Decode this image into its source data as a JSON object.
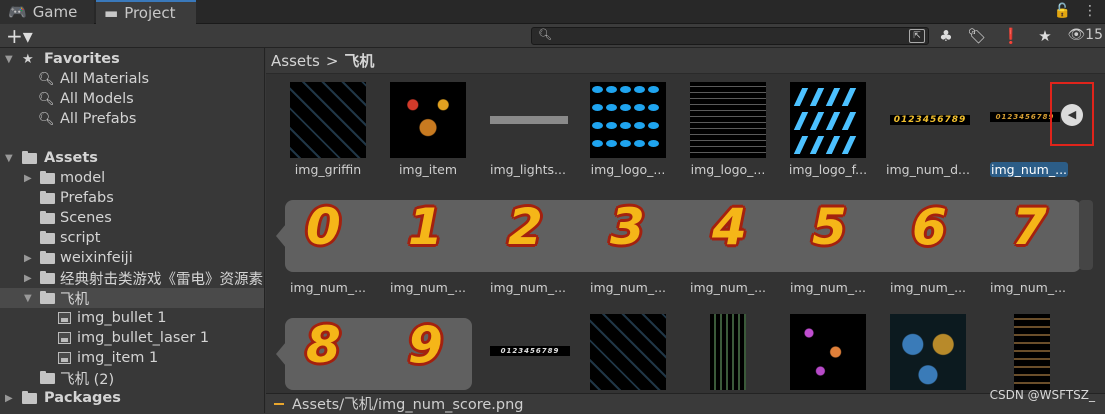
{
  "tabs": [
    {
      "label": "Game"
    },
    {
      "label": "Project"
    }
  ],
  "toolbar": {
    "add_label": "+▾",
    "hidden_count": "15"
  },
  "sidebar": {
    "favorites": {
      "label": "Favorites",
      "items": [
        "All Materials",
        "All Models",
        "All Prefabs"
      ]
    },
    "assets": {
      "label": "Assets",
      "folders": [
        "model",
        "Prefabs",
        "Scenes",
        "script",
        "weixinfeiji",
        "经典射击类游戏《雷电》资源素",
        "飞机"
      ]
    },
    "plane_children": [
      "img_bullet 1",
      "img_bullet_laser 1",
      "img_item 1"
    ],
    "plane2": "飞机 (2)",
    "packages": "Packages"
  },
  "breadcrumb": {
    "root": "Assets",
    "separator": ">",
    "current": "飞机"
  },
  "row1": [
    "img_griffin",
    "img_item",
    "img_lights...",
    "img_logo_...",
    "img_logo_...",
    "img_logo_f...",
    "img_num_d...",
    "img_num_..."
  ],
  "row2": [
    "img_num_...",
    "img_num_...",
    "img_num_...",
    "img_num_...",
    "img_num_...",
    "img_num_...",
    "img_num_...",
    "img_num_..."
  ],
  "digits_row2": [
    "0",
    "1",
    "2",
    "3",
    "4",
    "5",
    "6",
    "7"
  ],
  "digits_row3": [
    "8",
    "9"
  ],
  "num_strip_text": "0123456789",
  "status_path": "Assets/飞机/img_num_score.png",
  "watermark": "CSDN @WSFTSZ_",
  "colors": {
    "accent": "#2c5d87",
    "highlight_box": "#e0241b",
    "digit_fill": "#f5b618",
    "digit_stroke": "#a3210f"
  }
}
